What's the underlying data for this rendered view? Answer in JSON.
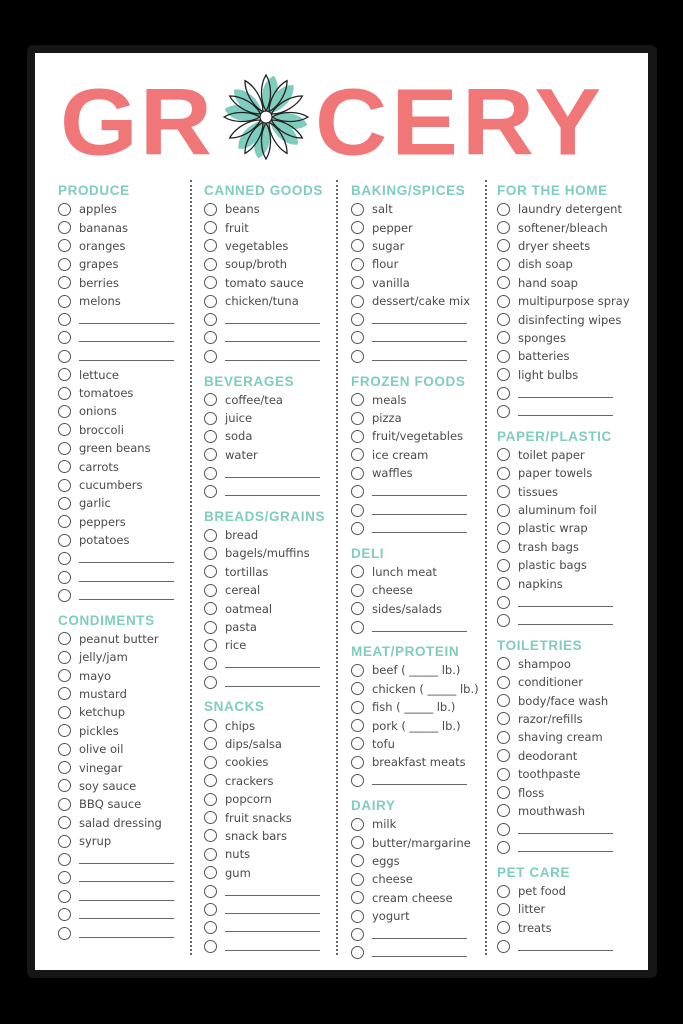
{
  "title": {
    "left": "GR",
    "right": "CERY"
  },
  "colors": {
    "title": "#f07677",
    "accent": "#7fcdbf",
    "text": "#4a4a4a",
    "background": "#ffffff"
  },
  "columns": [
    [
      {
        "name": "PRODUCE",
        "items": [
          "apples",
          "bananas",
          "oranges",
          "grapes",
          "berries",
          "melons",
          "",
          "",
          "",
          "lettuce",
          "tomatoes",
          "onions",
          "broccoli",
          "green beans",
          "carrots",
          "cucumbers",
          "garlic",
          "peppers",
          "potatoes",
          "",
          "",
          ""
        ]
      },
      {
        "name": "CONDIMENTS",
        "items": [
          "peanut butter",
          "jelly/jam",
          "mayo",
          "mustard",
          "ketchup",
          "pickles",
          "olive oil",
          "vinegar",
          "soy sauce",
          "BBQ sauce",
          "salad dressing",
          "syrup",
          "",
          "",
          "",
          "",
          ""
        ]
      }
    ],
    [
      {
        "name": "CANNED GOODS",
        "items": [
          "beans",
          "fruit",
          "vegetables",
          "soup/broth",
          "tomato sauce",
          "chicken/tuna",
          "",
          "",
          ""
        ]
      },
      {
        "name": "BEVERAGES",
        "items": [
          "coffee/tea",
          "juice",
          "soda",
          "water",
          "",
          ""
        ]
      },
      {
        "name": "BREADS/GRAINS",
        "items": [
          "bread",
          "bagels/muffins",
          "tortillas",
          "cereal",
          "oatmeal",
          "pasta",
          "rice",
          "",
          ""
        ]
      },
      {
        "name": "SNACKS",
        "items": [
          "chips",
          "dips/salsa",
          "cookies",
          "crackers",
          "popcorn",
          "fruit snacks",
          "snack bars",
          "nuts",
          "gum",
          "",
          "",
          "",
          ""
        ]
      }
    ],
    [
      {
        "name": "BAKING/SPICES",
        "items": [
          "salt",
          "pepper",
          "sugar",
          "flour",
          "vanilla",
          "dessert/cake mix",
          "",
          "",
          ""
        ]
      },
      {
        "name": "FROZEN FOODS",
        "items": [
          "meals",
          "pizza",
          "fruit/vegetables",
          "ice cream",
          "waffles",
          "",
          "",
          ""
        ]
      },
      {
        "name": "DELI",
        "items": [
          "lunch meat",
          "cheese",
          "sides/salads",
          ""
        ]
      },
      {
        "name": "MEAT/PROTEIN",
        "items": [
          "beef ( _____ lb.)",
          "chicken ( _____ lb.)",
          "fish ( _____ lb.)",
          "pork ( _____ lb.)",
          "tofu",
          "breakfast meats",
          ""
        ]
      },
      {
        "name": "DAIRY",
        "items": [
          "milk",
          "butter/margarine",
          "eggs",
          "cheese",
          "cream cheese",
          "yogurt",
          "",
          ""
        ]
      }
    ],
    [
      {
        "name": "FOR THE HOME",
        "items": [
          "laundry detergent",
          "softener/bleach",
          "dryer sheets",
          "dish soap",
          "hand soap",
          "multipurpose spray",
          "disinfecting wipes",
          "sponges",
          "batteries",
          "light bulbs",
          "",
          ""
        ]
      },
      {
        "name": "PAPER/PLASTIC",
        "items": [
          "toilet paper",
          "paper towels",
          "tissues",
          "aluminum foil",
          "plastic wrap",
          "trash bags",
          "plastic bags",
          "napkins",
          "",
          ""
        ]
      },
      {
        "name": "TOILETRIES",
        "items": [
          "shampoo",
          "conditioner",
          "body/face wash",
          "razor/refills",
          "shaving cream",
          "deodorant",
          "toothpaste",
          "floss",
          "mouthwash",
          "",
          ""
        ]
      },
      {
        "name": "PET CARE",
        "items": [
          "pet food",
          "litter",
          "treats",
          ""
        ]
      }
    ]
  ]
}
